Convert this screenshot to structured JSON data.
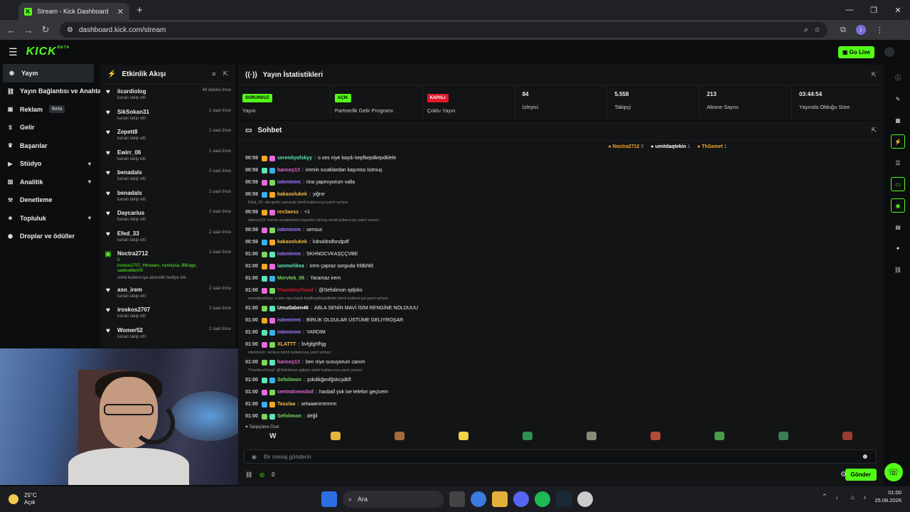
{
  "browser": {
    "tab_title": "Stream - Kick Dashboard",
    "url": "dashboard.kick.com/stream",
    "profile_initial": "I"
  },
  "header": {
    "logo": "KICK",
    "logo_tag": "BETA",
    "go_live": "Go Live"
  },
  "sidebar": {
    "items": [
      {
        "label": "Yayın",
        "icon": "broadcast-icon"
      },
      {
        "label": "Yayın Bağlantısı ve Anahtarı",
        "icon": "link-icon"
      },
      {
        "label": "Reklam",
        "icon": "ad-icon",
        "badge": "Beta"
      },
      {
        "label": "Gelir",
        "icon": "dollar-icon"
      },
      {
        "label": "Başarılar",
        "icon": "trophy-icon"
      },
      {
        "label": "Stüdyo",
        "icon": "studio-icon"
      },
      {
        "label": "Analitik",
        "icon": "analytics-icon"
      },
      {
        "label": "Denetleme",
        "icon": "hammer-icon"
      },
      {
        "label": "Topluluk",
        "icon": "community-icon"
      },
      {
        "label": "Droplar ve ödüller",
        "icon": "drops-icon"
      }
    ]
  },
  "activity": {
    "title": "Etkinlik Akışı",
    "events": [
      {
        "name": "iicardiolog",
        "sub": "kanalı takip etti",
        "time": "46 dakika önce"
      },
      {
        "name": "SikSokan31",
        "sub": "kanalı takip etti",
        "time": "1 saat önce"
      },
      {
        "name": "Zepett8",
        "sub": "kanalı takip etti",
        "time": "1 saat önce"
      },
      {
        "name": "Ewirr_06",
        "sub": "kanalı takip etti",
        "time": "1 saat önce"
      },
      {
        "name": "benadals",
        "sub": "kanalı takip etti",
        "time": "2 saat önce"
      },
      {
        "name": "benadals",
        "sub": "kanalı takip etti",
        "time": "2 saat önce"
      },
      {
        "name": "Daycarius",
        "sub": "kanalı takip etti",
        "time": "2 saat önce"
      },
      {
        "name": "Efed_33",
        "sub": "kanalı takip etti",
        "time": "2 saat önce"
      },
      {
        "name": "Noctra2712",
        "gift": "5\niroskos2707, Hhowars, rumieysa, BBrago, sadeceben00",
        "sub": "isimli kullanıcıya abonelik hediye etti.",
        "time": "2 saat önce"
      },
      {
        "name": "aso_irem",
        "sub": "kanalı takip etti",
        "time": "2 saat önce"
      },
      {
        "name": "iroskos2707",
        "sub": "kanalı takip etti",
        "time": "2 saat önce"
      },
      {
        "name": "Womer52",
        "sub": "kanalı takip etti",
        "time": "2 saat önce"
      }
    ]
  },
  "stats": {
    "title": "Yayın İstatistikleri",
    "cards": [
      {
        "pill": "SORUNSUZ",
        "pill_color": "green",
        "label": "Yayın"
      },
      {
        "pill": "AÇIK",
        "pill_color": "green",
        "label": "Partnerlik Gelir Programı"
      },
      {
        "pill": "KAPALI",
        "pill_color": "red",
        "label": "Çoklu Yayın"
      },
      {
        "value": "84",
        "label": "İzleyici"
      },
      {
        "value": "5.558",
        "label": "Takipçi"
      },
      {
        "value": "213",
        "label": "Abone Sayısı"
      },
      {
        "value": "03:44:54",
        "label": "Yayında Olduğu Süre"
      }
    ]
  },
  "chat": {
    "title": "Sohbet",
    "top_donors": [
      {
        "name": "Noctra2712",
        "count": "5",
        "color": "#f5a623"
      },
      {
        "name": "umitdaqtekin",
        "count": "1",
        "color": "#ffffff"
      },
      {
        "name": "ThSamet",
        "count": "1",
        "color": "#f5a623"
      }
    ],
    "messages": [
      {
        "time": "00:59",
        "user": "serenityofskyy",
        "color": "#5ce6b8",
        "text": "o ses niye kaydı kepfkepdkepdklele"
      },
      {
        "time": "00:59",
        "user": "hancey13",
        "color": "#e86ad8",
        "text": "iremin sıcaklardan kaşıntısı tutmuş"
      },
      {
        "time": "00:59",
        "user": "istemirem",
        "color": "#a47cff",
        "text": "ima yapmıyorum valla"
      },
      {
        "time": "00:59",
        "user": "kakaoolukek",
        "color": "#f5b942",
        "text": "yiğne"
      },
      {
        "reply": "Efed_33: abi gartic oynayak isimli kullanıcıya yanıt veriyor"
      },
      {
        "time": "00:59",
        "user": "rex3aess",
        "color": "#f5b942",
        "text": "+1"
      },
      {
        "reply": "hancey13: iremin sıcaklardan kaşıntısı tutmuş isimli kullanıcıya yanıt veriyor"
      },
      {
        "time": "00:59",
        "user": "istemirem",
        "color": "#a47cff",
        "text": "sensus"
      },
      {
        "time": "00:59",
        "user": "kakaoolukek",
        "color": "#f5b942",
        "text": "kdnxldndlsndpdf"
      },
      {
        "time": "01:00",
        "user": "istemirem",
        "color": "#a47cff",
        "text": "SKHNDCVKAŞÇÇVBE"
      },
      {
        "time": "01:00",
        "user": "iammelikea",
        "color": "#5ce6b8",
        "text": "irem çapraz sorguda hfdbhfd"
      },
      {
        "time": "01:00",
        "user": "Mervtek_06",
        "color": "#7cd65a",
        "text": "Yaramaz irem"
      },
      {
        "time": "01:00",
        "user": "ThumbcuYusuf",
        "color": "#e0182a",
        "text": "@Sefolimon sjdjsks"
      },
      {
        "reply": "serenityofskyy: o ses niye kaydı kepfkepdkepdklele isimli kullanıcıya yanıt veriyor"
      },
      {
        "time": "01:00",
        "user": "Umutlaben46",
        "color": "#ffffff",
        "text": "ABLA SENİN MAVİ İSİM RENGİNE NOLDUUU"
      },
      {
        "time": "01:00",
        "user": "istemirem",
        "color": "#a47cff",
        "text": "BİRLİK OLDULAR ÜSTÜME GELIYROŞAR"
      },
      {
        "time": "01:00",
        "user": "istemirem",
        "color": "#a47cff",
        "text": "YARDIM"
      },
      {
        "time": "01:00",
        "user": "XLATTT",
        "color": "#f5b942",
        "text": "bvfgfghfhjg"
      },
      {
        "reply": "istemirem: sensus isimli kullanıcıya yanıt veriyor"
      },
      {
        "time": "01:00",
        "user": "hancey13",
        "color": "#e86ad8",
        "text": "ben niye susuyorum canım"
      },
      {
        "reply": "ThumbcuYusuf: @Sefolimon sjdjsks isimli kullanıcıya yanıt veriyor"
      },
      {
        "time": "01:00",
        "user": "Sefolimon",
        "color": "#7cd65a",
        "text": "şskdikğeofğskcşdkfl"
      },
      {
        "time": "01:00",
        "user": "centralceexdxd",
        "color": "#e86ad8",
        "text": "haxball yok ise telefon geçicem"
      },
      {
        "time": "01:00",
        "user": "Tasulaa",
        "color": "#f5b942",
        "text": "selaaammmmm"
      },
      {
        "time": "01:00",
        "user": "Sefolimon",
        "color": "#7cd65a",
        "text": "değil"
      }
    ],
    "followers_only_label": "Takipçilere Özel",
    "input_placeholder": "Bir mesaj gönderin",
    "footer_count": "0",
    "send_label": "Gönder"
  },
  "taskbar": {
    "temperature": "25°C",
    "condition": "Açık",
    "search_label": "Ara",
    "time": "01:00",
    "date": "25.08.2026"
  }
}
